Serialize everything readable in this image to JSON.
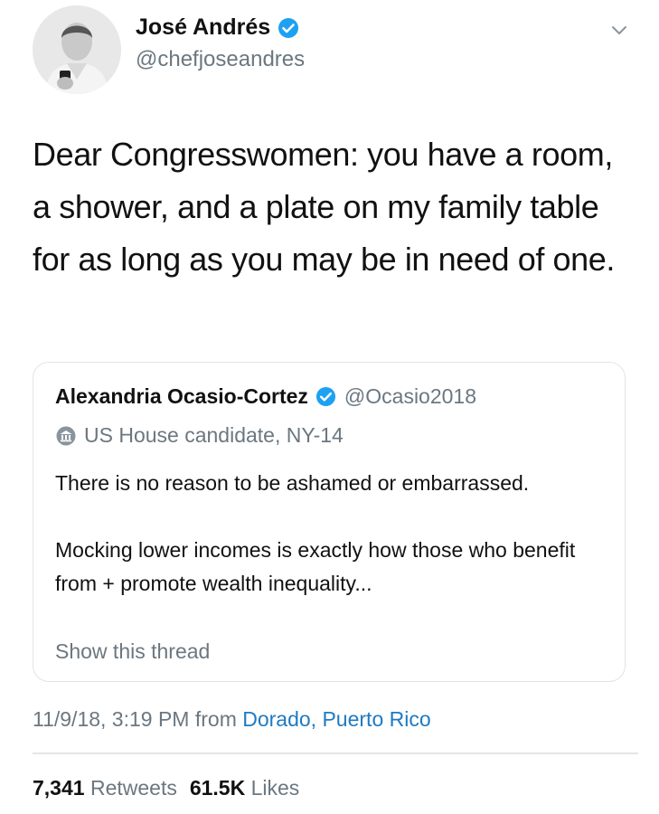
{
  "author": {
    "name": "José Andrés",
    "handle": "@chefjoseandres",
    "verified": true
  },
  "tweet": {
    "text": "Dear Congresswomen: you have a room, a shower, and a plate on my family table for as long as you may be in need of one."
  },
  "quoted_tweet": {
    "author_name": "Alexandria Ocasio-Cortez",
    "author_handle": "@Ocasio2018",
    "verified": true,
    "label": "US House candidate, NY-14",
    "paragraph1": "There is no reason to be ashamed or embarrassed.",
    "paragraph2": "Mocking lower incomes is exactly how those who benefit from + promote wealth inequality...",
    "show_thread": "Show this thread"
  },
  "meta": {
    "timestamp": "11/9/18, 3:19 PM from",
    "location": "Dorado, Puerto Rico"
  },
  "stats": {
    "retweets_count": "7,341",
    "retweets_label": "Retweets",
    "likes_count": "61.5K",
    "likes_label": "Likes"
  },
  "colors": {
    "verified_badge": "#1da1f2",
    "link": "#1f7ac2",
    "secondary_text": "#6b7780"
  },
  "icons": {
    "verified": "verified-badge-icon",
    "caret": "chevron-down-icon",
    "government": "government-building-icon"
  }
}
